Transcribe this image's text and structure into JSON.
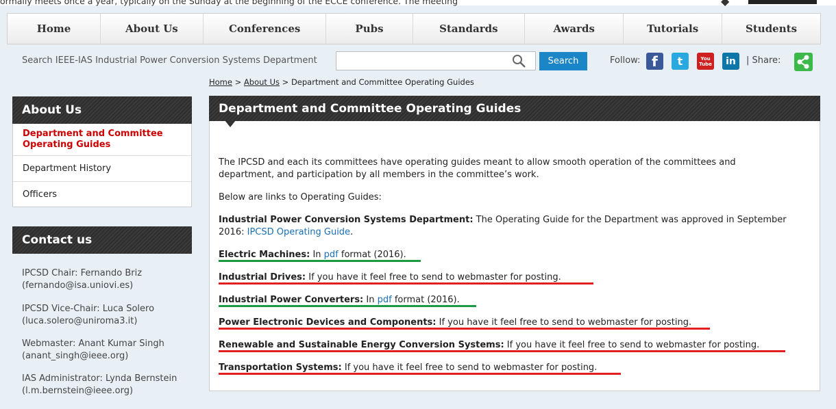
{
  "top_text": "ormally meets once a year, typically on the Sunday at the beginning of the ECCE conference.  The meeting",
  "nav": [
    "Home",
    "About Us",
    "Conferences",
    "Pubs",
    "Standards",
    "Awards",
    "Tutorials",
    "Students"
  ],
  "search": {
    "label": "Search IEEE-IAS Industrial Power Conversion Systems Department",
    "value": "",
    "button": "Search"
  },
  "social": {
    "follow_label": "Follow:",
    "share_label": "| Share:",
    "icons": [
      "facebook-icon",
      "twitter-icon",
      "youtube-icon",
      "linkedin-icon",
      "share-icon"
    ],
    "facebook_glyph": "f",
    "twitter_glyph": "t",
    "youtube_glyph": "You\nTube",
    "linkedin_glyph": "in"
  },
  "breadcrumb": {
    "home": "Home",
    "sep1": " > ",
    "about": "About Us",
    "sep2": " > ",
    "current": "Department and Committee Operating Guides"
  },
  "sidebar": {
    "title": "About Us",
    "items": [
      {
        "label": "Department and Committee Operating Guides",
        "active": true
      },
      {
        "label": "Department History",
        "active": false
      },
      {
        "label": "Officers",
        "active": false
      }
    ]
  },
  "contact": {
    "title": "Contact us",
    "entries": [
      {
        "line1": "IPCSD Chair: Fernando Briz",
        "line2": "(fernando@isa.uniovi.es)"
      },
      {
        "line1": "IPCSD Vice-Chair: Luca Solero",
        "line2": "(luca.solero@uniroma3.it)"
      },
      {
        "line1": "Webmaster: Anant Kumar Singh",
        "line2": "(anant_singh@ieee.org)"
      },
      {
        "line1": "IAS Administrator: Lynda Bernstein",
        "line2": "(l.m.bernstein@ieee.org)"
      }
    ]
  },
  "main": {
    "title": "Department and Committee Operating Guides",
    "intro1": "The IPCSD and each its committees have operating guides meant to allow smooth operation of the committees and",
    "intro2": "department, and participation by all members in the committee’s work.",
    "below": "Below are links to Operating Guides:",
    "ipcsd_bold": "Industrial Power Conversion Systems Department:",
    "ipcsd_text1": " The Operating Guide for the Department was approved in September",
    "ipcsd_text2": "2016:  ",
    "ipcsd_link": "IPCSD Operating Guide",
    "ipcsd_end": ".",
    "committees": [
      {
        "name": "Electric Machines:",
        "pre": "  In ",
        "link": "pdf",
        "post": " format (2016).",
        "status": "available"
      },
      {
        "name": "Industrial Drives:",
        "pre": "  If you have it feel free to send to webmaster for posting.",
        "link": "",
        "post": "",
        "status": "missing"
      },
      {
        "name": "Industrial Power Converters:",
        "pre": "  In ",
        "link": "pdf",
        "post": " format (2016).",
        "status": "available"
      },
      {
        "name": "Power Electronic Devices and Components:",
        "pre": "  If you have it feel free to send to webmaster for posting.",
        "link": "",
        "post": "",
        "status": "missing"
      },
      {
        "name": "Renewable and Sustainable Energy Conversion Systems:",
        "pre": "  If you have it feel free to send to webmaster for posting.",
        "link": "",
        "post": "",
        "status": "missing"
      },
      {
        "name": "Transportation Systems:",
        "pre": "  If you have it feel free to send to webmaster for posting.",
        "link": "",
        "post": "",
        "status": "missing"
      }
    ]
  },
  "colors": {
    "available_underline": "#1a9a44",
    "missing_underline": "#e41e1e",
    "accent_blue": "#1a86c8",
    "active_red": "#cc0000"
  }
}
